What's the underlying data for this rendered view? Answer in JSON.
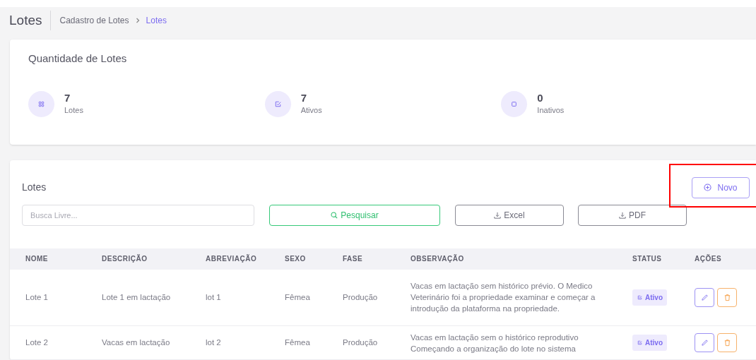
{
  "header": {
    "title": "Lotes",
    "breadcrumb": [
      {
        "label": "Cadastro de Lotes",
        "selected": false
      },
      {
        "label": "Lotes",
        "selected": true
      }
    ]
  },
  "summary": {
    "title": "Quantidade de Lotes",
    "stats": [
      {
        "kind": "grid",
        "value": "7",
        "label": "Lotes"
      },
      {
        "kind": "check",
        "value": "7",
        "label": "Ativos"
      },
      {
        "kind": "square",
        "value": "0",
        "label": "Inativos"
      }
    ]
  },
  "list": {
    "title": "Lotes",
    "new_button": {
      "label": "Novo",
      "highlighted": true
    },
    "search": {
      "placeholder": "Busca Livre..."
    },
    "buttons": [
      {
        "kind": "search",
        "label": "Pesquisar"
      },
      {
        "kind": "download",
        "label": "Excel"
      },
      {
        "kind": "download",
        "label": "PDF"
      }
    ],
    "table": {
      "columns": [
        "NOME",
        "DESCRIÇÃO",
        "ABREVIAÇÃO",
        "SEXO",
        "FASE",
        "OBSERVAÇÃO",
        "STATUS",
        "AÇÕES"
      ],
      "rows": [
        {
          "cells": [
            "Lote 1",
            "Lote 1 em lactação",
            "lot 1",
            "Fêmea",
            "Produção",
            "Vacas em lactação sem histórico prévio. O Medico Veterinário foi a propriedade examinar e começar a introdução da plataforma na propriedade."
          ],
          "status": "Ativo"
        },
        {
          "cells": [
            "Lote 2",
            "Vacas em lactação",
            "lot 2",
            "Fêmea",
            "Produção",
            "Vacas em lactação sem o histórico reprodutivo Começando a organização do lote no sistema"
          ],
          "status": "Ativo"
        }
      ]
    }
  }
}
